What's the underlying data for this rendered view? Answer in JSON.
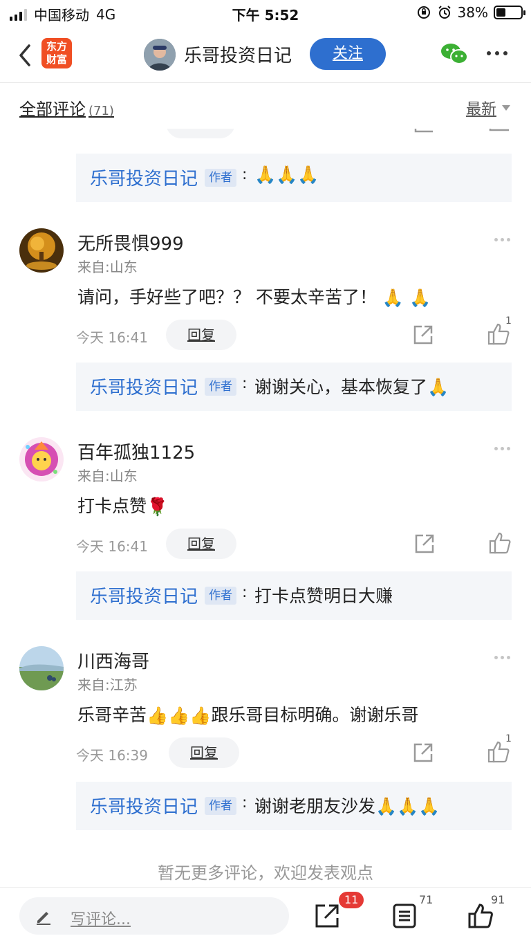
{
  "status_bar": {
    "carrier": "中国移动",
    "network": "4G",
    "time": "下午 5:52",
    "battery": "38%",
    "battery_level": 0.38
  },
  "nav": {
    "logo_line1": "东方",
    "logo_line2": "财富",
    "title": "乐哥投资日记",
    "follow_label": "关注",
    "wechat_icon": "wechat-icon",
    "more_icon": "more-icon"
  },
  "section": {
    "title": "全部评论",
    "count": "(71)",
    "sort_label": "最新"
  },
  "comments": [
    {
      "name": "无所畏惧999",
      "from": "来自:山东",
      "text": "请问，手好些了吧？？ 不要太辛苦了！",
      "emoji": "🙏 🙏",
      "time": "今天 16:41",
      "reply_label": "回复",
      "likes": "1",
      "author_reply": {
        "name": "乐哥投资日记",
        "badge": "作者",
        "colon": ":",
        "text": "谢谢关心，基本恢复了",
        "emoji": "🙏"
      }
    },
    {
      "name": "百年孤独1125",
      "from": "来自:山东",
      "text": "打卡点赞",
      "emoji": "🌹",
      "time": "今天 16:41",
      "reply_label": "回复",
      "likes": "",
      "author_reply": {
        "name": "乐哥投资日记",
        "badge": "作者",
        "colon": ":",
        "text": "打卡点赞明日大赚",
        "emoji": ""
      }
    },
    {
      "name": "川西海哥",
      "from": "来自:江苏",
      "text_before": "乐哥辛苦",
      "emoji_mid": "👍👍👍",
      "text_after": "跟乐哥目标明确。谢谢乐哥",
      "time": "今天 16:39",
      "reply_label": "回复",
      "likes": "1",
      "author_reply": {
        "name": "乐哥投资日记",
        "badge": "作者",
        "colon": ":",
        "text": "谢谢老朋友沙发",
        "emoji": "🙏🙏🙏"
      }
    }
  ],
  "top_reply": {
    "name": "乐哥投资日记",
    "badge": "作者",
    "colon": ":",
    "emoji": "🙏🙏🙏"
  },
  "end_tip": "暂无更多评论，欢迎发表观点",
  "bottom": {
    "write_label": "写评论...",
    "share_badge": "11",
    "comment_count": "71",
    "like_count": "91"
  }
}
